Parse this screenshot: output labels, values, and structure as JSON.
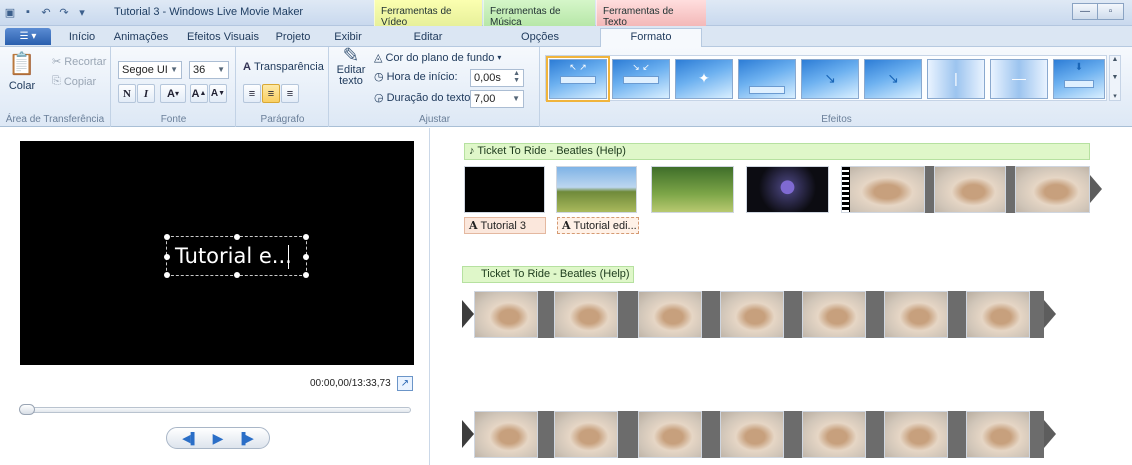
{
  "window": {
    "title": "Tutorial 3 - Windows Live Movie Maker",
    "contextual_tabs": [
      "Ferramentas de Vídeo",
      "Ferramentas de Música",
      "Ferramentas de Texto"
    ]
  },
  "ribbon_tabs": [
    "Início",
    "Animações",
    "Efeitos Visuais",
    "Projeto",
    "Exibir",
    "Editar",
    "Opções",
    "Formato"
  ],
  "active_tab": "Formato",
  "clipboard": {
    "paste": "Colar",
    "cut": "Recortar",
    "copy": "Copiar",
    "label": "Área de Transferência"
  },
  "font": {
    "family": "Segoe UI",
    "size": "36",
    "bold": "N",
    "italic": "I",
    "color_btn": "A",
    "grow": "A",
    "shrink": "A",
    "label": "Fonte"
  },
  "paragraph": {
    "transparency": "Transparência",
    "label": "Parágrafo"
  },
  "adjust": {
    "edit_text": "Editar texto",
    "bg_color": "Cor do plano de fundo",
    "start_time_label": "Hora de início:",
    "start_time_value": "0,00s",
    "duration_label": "Duração do texto:",
    "duration_value": "7,00",
    "label": "Ajustar"
  },
  "effects": {
    "label": "Efeitos",
    "count": 10,
    "selected_index": 0
  },
  "preview": {
    "caption": "Tutorial e...",
    "timecode": "00:00,00/13:33,73",
    "seek_position": 0
  },
  "storyboard": {
    "row1_music": "Ticket To Ride - Beatles (Help)",
    "row1_text_chips": [
      "Tutorial 3",
      "Tutorial edi..."
    ],
    "row2_music": "Ticket To Ride - Beatles (Help)"
  }
}
